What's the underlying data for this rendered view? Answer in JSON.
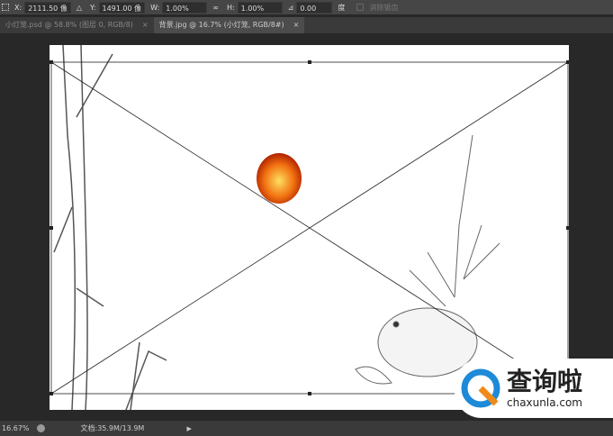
{
  "options_bar": {
    "x_label": "X:",
    "x_value": "2111.50 像",
    "y_label": "Y:",
    "y_value": "1491.00 像",
    "w_label": "W:",
    "w_value": "1.00%",
    "h_label": "H:",
    "h_value": "1.00%",
    "angle_value": "0.00",
    "angle_unit": "度",
    "antialias_label": "消除锯齿"
  },
  "tabs": [
    {
      "label": "小灯笼.psd @ 58.8% (图层 0, RGB/8)",
      "close": "×"
    },
    {
      "label": "背景.jpg @ 16.7% (小灯笼, RGB/8#)",
      "close": "×"
    }
  ],
  "status": {
    "zoom": "16.67%",
    "doc": "文档:35.9M/13.9M"
  },
  "watermark": {
    "name": "查询啦",
    "url": "chaxunla.com"
  },
  "colors": {
    "accent_blue": "#1e8ad8",
    "accent_orange": "#f08a18"
  }
}
